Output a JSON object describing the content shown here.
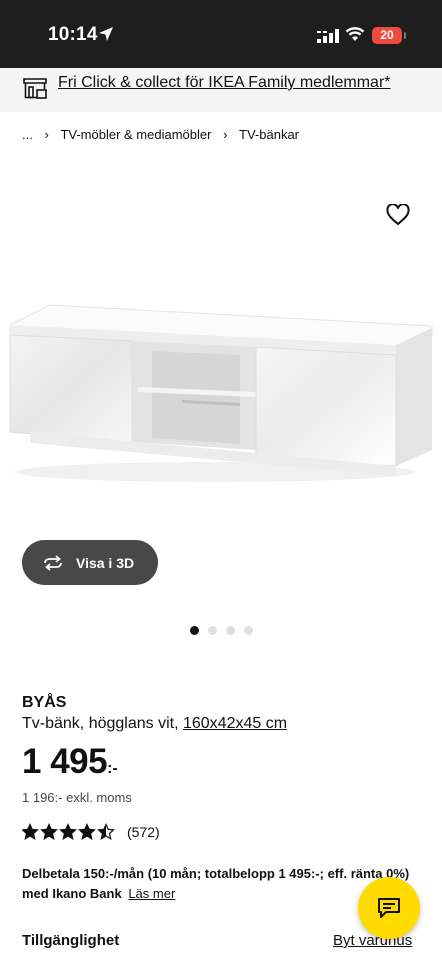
{
  "status_bar": {
    "time": "10:14",
    "battery": "20",
    "icons": [
      "location-arrow-icon",
      "signal-icon",
      "wifi-icon",
      "battery-icon"
    ]
  },
  "promo": {
    "icon": "store-icon",
    "text": "Fri Click & collect för IKEA Family medlemmar*"
  },
  "breadcrumb": {
    "ellipsis": "...",
    "items": [
      "TV-möbler & mediamöbler",
      "TV-bänkar"
    ]
  },
  "gallery": {
    "view_3d_label": "Visa i 3D",
    "slide_count": 4,
    "active_slide": 1,
    "favourite_icon": "heart-icon"
  },
  "product": {
    "name": "BYÅS",
    "description": "Tv-bänk, högglans vit,",
    "dimensions": "160x42x45 cm",
    "price": "1 495",
    "price_suffix": ":-",
    "price_excl_vat": "1 196:- exkl. moms",
    "rating": 4.5,
    "rating_max": 5,
    "review_count": "(572)"
  },
  "finance": {
    "text": "Delbetala 150:-/mån (10 mån; totalbelopp 1 495:-; eff. ränta 0%) med Ikano Bank",
    "link": "Läs mer"
  },
  "availability": {
    "label": "Tillgänglighet",
    "change_store": "Byt varuhus"
  },
  "chat": {
    "icon": "chat-icon"
  },
  "colors": {
    "status_bar_bg": "#1e1e1e",
    "battery_red": "#ef4a3f",
    "chat_yellow": "#ffdb00",
    "view3d_bg": "#484848"
  }
}
